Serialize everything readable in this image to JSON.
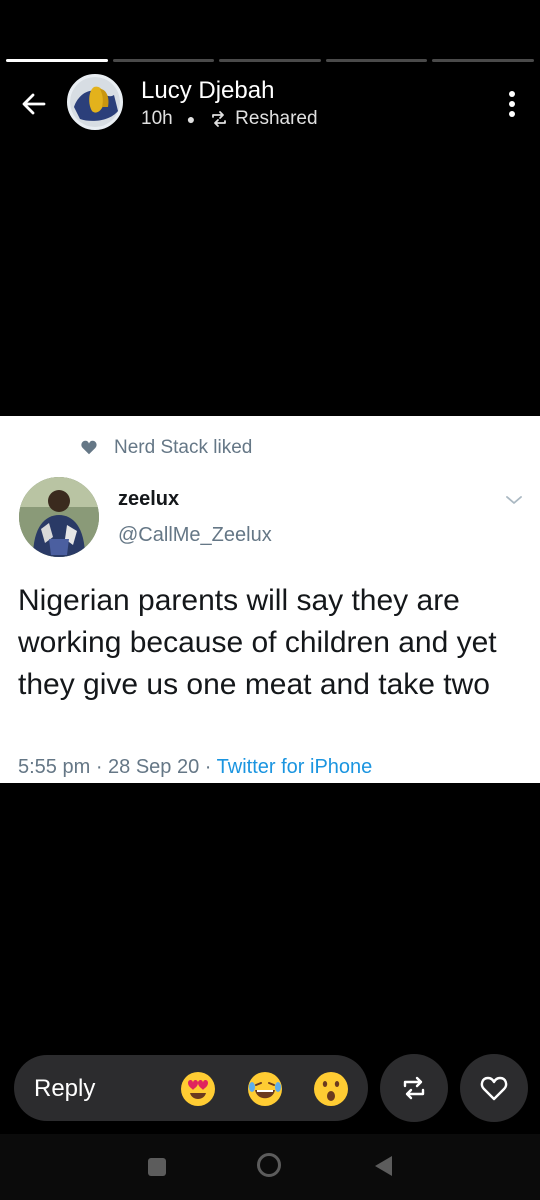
{
  "story": {
    "progress": {
      "segments": 5,
      "active_index": 0
    },
    "author": {
      "name": "Lucy Djebah"
    },
    "time": "10h",
    "reshared_label": "Reshared"
  },
  "tweet": {
    "liked_by_text": "Nerd Stack liked",
    "name": "zeelux",
    "handle": "@CallMe_Zeelux",
    "text": "Nigerian parents will say they are working because of children and yet they give us one meat and take two",
    "timestamp": "5:55 pm · 28 Sep 20 · ",
    "source": "Twitter for iPhone"
  },
  "reply_bar": {
    "label": "Reply",
    "reactions": [
      "heart-eyes-emoji",
      "laughing-tears-emoji",
      "surprised-emoji"
    ]
  },
  "icons": {
    "back": "arrow-left-icon",
    "more": "vertical-dots-icon",
    "reshare": "reshare-icon",
    "like": "heart-icon"
  },
  "colors": {
    "background": "#000000",
    "card": "#ffffff",
    "twitter_blue": "#1b95e0",
    "muted": "#657786"
  }
}
